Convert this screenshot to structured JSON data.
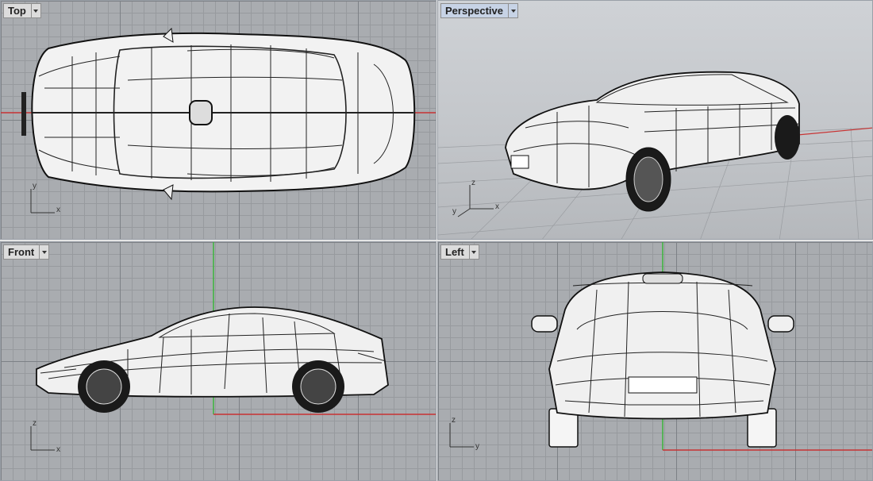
{
  "viewports": {
    "top": {
      "label": "Top",
      "axes": [
        "y",
        "x"
      ]
    },
    "perspective": {
      "label": "Perspective",
      "axes": [
        "z",
        "y",
        "x"
      ]
    },
    "front": {
      "label": "Front",
      "axes": [
        "z",
        "x"
      ]
    },
    "left": {
      "label": "Left",
      "axes": [
        "z",
        "y"
      ]
    }
  },
  "colors": {
    "grid_major": "#7d8186",
    "grid_minor": "#979a9e",
    "viewport_bg": "#a9acb0",
    "axis_x": "#c83232",
    "axis_y": "#3cb43c",
    "wire": "#111111",
    "active_tab": "#c7d3e6"
  },
  "icons": {
    "dropdown": "chevron-down-icon",
    "axis": "axis-gizmo-icon"
  }
}
